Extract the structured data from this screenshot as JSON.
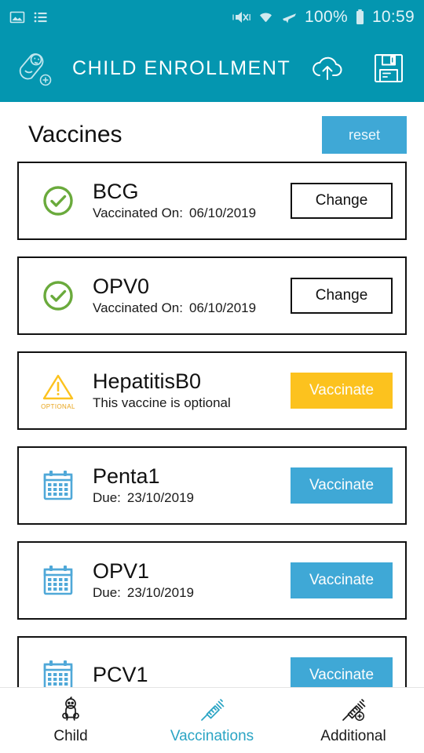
{
  "status_bar": {
    "left_icons": [
      "image-icon",
      "list-icon"
    ],
    "right_icons": [
      "vibrate-mute-icon",
      "wifi-icon",
      "airplane-mode-icon",
      "battery-icon"
    ],
    "battery_percent": "100%",
    "time": "10:59"
  },
  "app_bar": {
    "logo_icon": "baby-add-icon",
    "title": "CHILD ENROLLMENT",
    "actions": [
      {
        "icon": "cloud-upload-icon",
        "name": "cloud-upload-button"
      },
      {
        "icon": "save-floppy-icon",
        "name": "save-button"
      }
    ]
  },
  "section": {
    "title": "Vaccines",
    "reset_label": "reset"
  },
  "colors": {
    "header_teal": "#0496B0",
    "accent_blue": "#3FA8D6",
    "optional_amber": "#FCC21E",
    "done_green": "#6AAA3C",
    "calendar_blue": "#4FA8D8"
  },
  "vaccines": [
    {
      "name": "BCG",
      "status": "done",
      "icon": "check-circle-icon",
      "sub_label": "Vaccinated On:",
      "sub_value": "06/10/2019",
      "action_label": "Change",
      "action_style": "outline"
    },
    {
      "name": "OPV0",
      "status": "done",
      "icon": "check-circle-icon",
      "sub_label": "Vaccinated On:",
      "sub_value": "06/10/2019",
      "action_label": "Change",
      "action_style": "outline"
    },
    {
      "name": "HepatitisB0",
      "status": "optional",
      "icon": "warning-triangle-icon",
      "icon_caption": "OPTIONAL",
      "sub_label": "This vaccine is optional",
      "sub_value": "",
      "action_label": "Vaccinate",
      "action_style": "amber"
    },
    {
      "name": "Penta1",
      "status": "due",
      "icon": "calendar-icon",
      "sub_label": "Due:",
      "sub_value": "23/10/2019",
      "action_label": "Vaccinate",
      "action_style": "blue"
    },
    {
      "name": "OPV1",
      "status": "due",
      "icon": "calendar-icon",
      "sub_label": "Due:",
      "sub_value": "23/10/2019",
      "action_label": "Vaccinate",
      "action_style": "blue"
    },
    {
      "name": "PCV1",
      "status": "due",
      "icon": "calendar-icon",
      "sub_label": "",
      "sub_value": "",
      "action_label": "Vaccinate",
      "action_style": "blue"
    }
  ],
  "bottom_nav": [
    {
      "label": "Child",
      "icon": "baby-icon",
      "active": false
    },
    {
      "label": "Vaccinations",
      "icon": "syringe-icon",
      "active": true
    },
    {
      "label": "Additional",
      "icon": "syringe-add-icon",
      "active": false
    }
  ]
}
